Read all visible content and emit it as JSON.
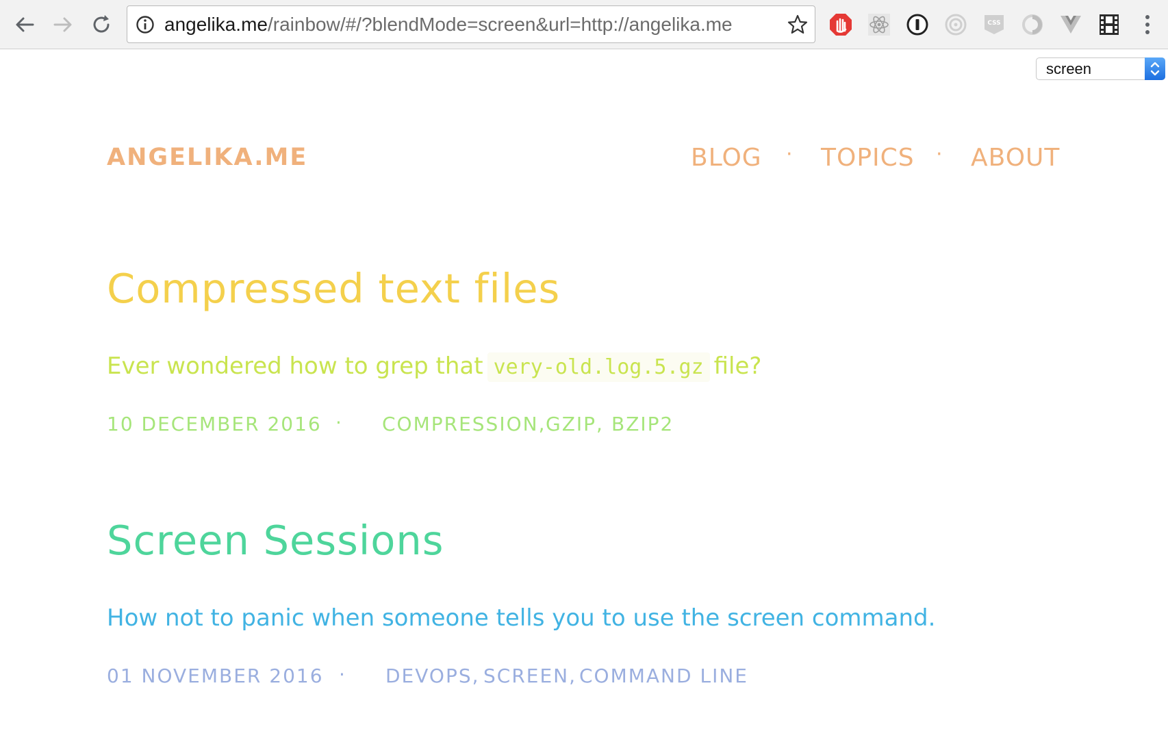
{
  "browser": {
    "url_host": "angelika.me",
    "url_path": "/rainbow/#/?blendMode=screen&url=http://angelika.me",
    "extensions": [
      "adblock-icon",
      "react-devtools-icon",
      "onepassword-icon",
      "target-icon",
      "css-icon",
      "swirl-icon",
      "vue-devtools-icon",
      "film-icon"
    ]
  },
  "blend_select": {
    "value": "screen"
  },
  "site": {
    "brand": "ANGELIKA.ME",
    "nav": [
      "BLOG",
      "TOPICS",
      "ABOUT"
    ],
    "separator": "·"
  },
  "posts": [
    {
      "title": "Compressed text files",
      "subtitle_before": "Ever wondered how to grep that",
      "subtitle_code": "very-old.log.5.gz",
      "subtitle_after": "file?",
      "date": "10 DECEMBER 2016",
      "tags": [
        "COMPRESSION,",
        "GZIP,",
        "BZIP2"
      ],
      "colors": {
        "title": "#f4d04c",
        "subtitle": "#c9e44f",
        "meta": "#a6e57a"
      }
    },
    {
      "title": "Screen Sessions",
      "subtitle": "How not to panic when someone tells you to use the screen command.",
      "date": "01 NOVEMBER 2016",
      "tags": [
        "DEVOPS,",
        "SCREEN,",
        "COMMAND LINE"
      ],
      "colors": {
        "title": "#4ed59b",
        "subtitle": "#41b3e3",
        "meta": "#9aaedf"
      }
    }
  ]
}
